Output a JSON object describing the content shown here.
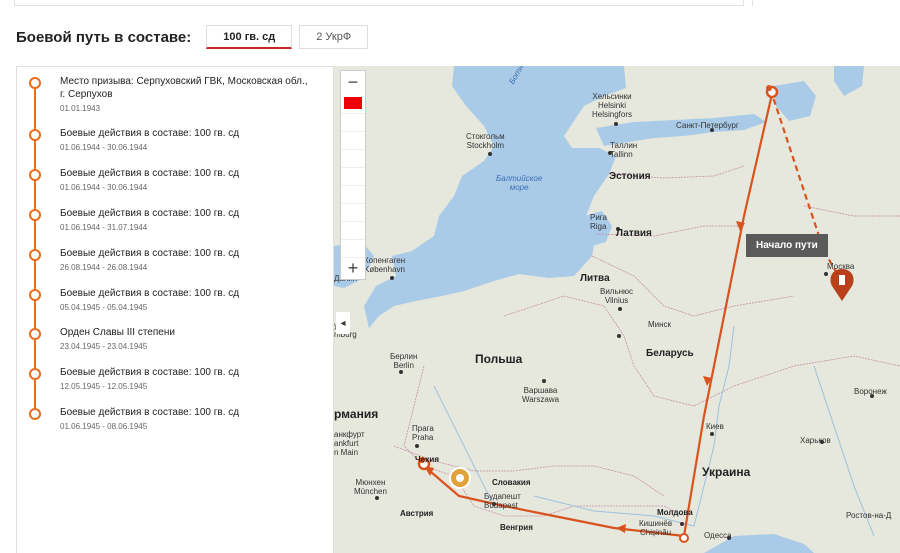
{
  "header": {
    "title": "Боевой путь в составе:"
  },
  "tabs": [
    {
      "label": "100 гв. сд",
      "active": true
    },
    {
      "label": "2 УкрФ",
      "active": false
    }
  ],
  "events": [
    {
      "title": "Место призыва: Серпуховский ГВК, Московская обл., г. Серпухов",
      "date": "01.01.1943"
    },
    {
      "title": "Боевые действия в составе: 100 гв. сд",
      "date": "01.06.1944 - 30.06.1944"
    },
    {
      "title": "Боевые действия в составе: 100 гв. сд",
      "date": "01.06.1944 - 30.06.1944"
    },
    {
      "title": "Боевые действия в составе: 100 гв. сд",
      "date": "01.06.1944 - 31.07.1944"
    },
    {
      "title": "Боевые действия в составе: 100 гв. сд",
      "date": "26.08.1944 - 26.08.1944"
    },
    {
      "title": "Боевые действия в составе: 100 гв. сд",
      "date": "05.04.1945 - 05.04.1945"
    },
    {
      "title": "Орден Славы III степени",
      "date": "23.04.1945 - 23.04.1945"
    },
    {
      "title": "Боевые действия в составе: 100 гв. сд",
      "date": "12.05.1945 - 12.05.1945"
    },
    {
      "title": "Боевые действия в составе: 100 гв. сд",
      "date": "01.06.1945 - 08.06.1945"
    }
  ],
  "map": {
    "tooltip": "Начало пути",
    "zoom_in": "+",
    "zoom_out": "−",
    "collapse": "◂",
    "labels": {
      "helsinki": "Хельсинки\nHelsinki\nHelsingfors",
      "stpete": "Санкт-Петербург",
      "stockholm": "Стокгольм\nStockholm",
      "tallinn": "Таллин\nTallinn",
      "baltic": "Балтийское\nморе",
      "estonia": "Эстония",
      "riga": "Рига\nRiga",
      "latvia": "Латвия",
      "copenhagen": "Копенгаген\nKøbenhavn",
      "lithuania": "Литва",
      "vilnius": "Вильнюс\nVilnius",
      "minsk": "Минск",
      "moscow": "Москва",
      "belarus": "Беларусь",
      "berlin": "Берлин\nBerlin",
      "poland": "Польша",
      "warsaw": "Варшава\nWarszawa",
      "voronezh": "Воронеж",
      "germany": "рмания",
      "frankfurt": "анкфурт\nankfurt\nn Main",
      "prague": "Прага\nPraha",
      "czech": "Чехия",
      "kyiv": "Киев",
      "kharkov": "Харьков",
      "ukraine": "Украина",
      "munich": "Мюнхен\nMünchen",
      "slovakia": "Словакия",
      "budapest": "Будапешт\nBudapest",
      "austria": "Австрия",
      "hungary": "Венгрия",
      "moldova": "Молдова",
      "chisinau": "Кишинёв\nChișinău",
      "odessa": "Одесса",
      "rostov": "Ростов-на-Д",
      "hamburg": "ург\nmburg",
      "bothnia": "Ботн",
      "danmark": "Дания"
    }
  },
  "colors": {
    "route": "#d9531e",
    "accent": "#c62828",
    "water": "#a9cbe8",
    "land": "#e6e7dd",
    "tooltip": "#5a5a5a"
  }
}
